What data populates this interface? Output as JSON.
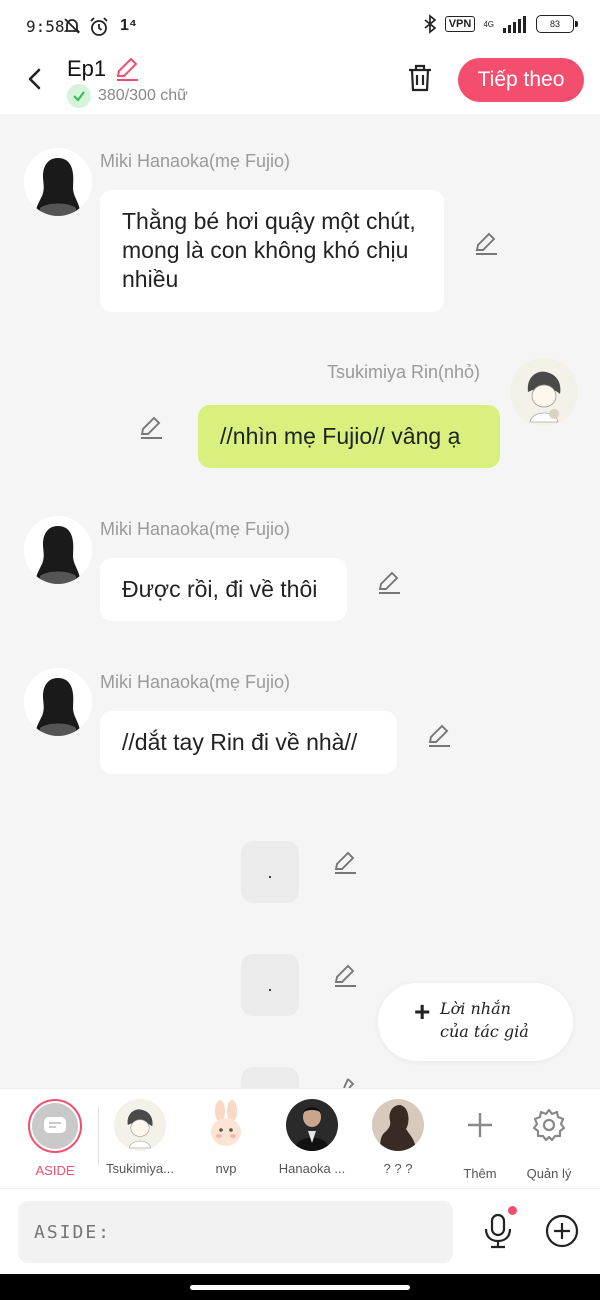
{
  "status_bar": {
    "time": "9:58",
    "signal_label": "1⁴",
    "vpn": "VPN",
    "network": "4G",
    "battery": "83"
  },
  "header": {
    "title": "Ep1",
    "word_count": "380/300 chữ",
    "next_label": "Tiếp theo"
  },
  "messages": [
    {
      "speaker": "Miki Hanaoka(mẹ Fujio)",
      "text": "Thằng bé hơi quậy một chút, mong là con không khó chịu  nhiều"
    },
    {
      "speaker": "Tsukimiya Rin(nhỏ)",
      "text": "//nhìn mẹ Fujio// vâng ạ"
    },
    {
      "speaker": "Miki Hanaoka(mẹ Fujio)",
      "text": "Được rồi, đi về thôi"
    },
    {
      "speaker": "Miki Hanaoka(mẹ Fujio)",
      "text": "//dắt tay Rin đi về nhà//"
    },
    {
      "text": "."
    },
    {
      "text": "."
    }
  ],
  "author_note": {
    "line1": "Lời nhắn",
    "line2": "của tác giả"
  },
  "characters": [
    {
      "label": "ASIDE",
      "active": true
    },
    {
      "label": "Tsukimiya..."
    },
    {
      "label": "nvp"
    },
    {
      "label": "Hanaoka ..."
    },
    {
      "label": "? ? ?"
    },
    {
      "label": "Thêm"
    },
    {
      "label": "Quản lý"
    }
  ],
  "input": {
    "placeholder": "ASIDE:"
  },
  "colors": {
    "accent": "#f34e6e",
    "green_bubble": "#d9f07f",
    "background": "#f5f5f5"
  }
}
